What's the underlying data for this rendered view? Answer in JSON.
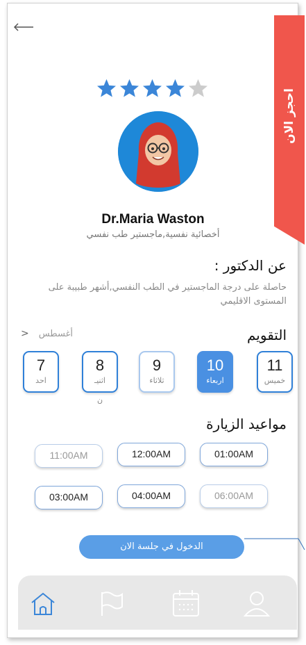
{
  "ribbon": {
    "label": "احجز الان"
  },
  "rating": {
    "value": 4,
    "max": 5,
    "filled_color": "#3b86d8",
    "empty_color": "#cccccc"
  },
  "doctor": {
    "name": "Dr.Maria Waston",
    "title": "أخصائية نفسية,ماجستير طب نفسي"
  },
  "about": {
    "heading": "عن الدكتور :",
    "text": "حاصلة على درجة الماجستير في الطب النفسي,أشهر طبيبة على المستوى الاقليمي"
  },
  "calendar": {
    "heading": "التقويم",
    "month": "أغسطس",
    "days": [
      {
        "num": "11",
        "label": "خميس",
        "active": false
      },
      {
        "num": "10",
        "label": "اربعاء",
        "active": true
      },
      {
        "num": "9",
        "label": "ثلاثاء",
        "active": false
      },
      {
        "num": "8",
        "label": "اثنيـ",
        "extra": "ن",
        "active": false
      },
      {
        "num": "7",
        "label": "احد",
        "active": false
      }
    ]
  },
  "visits": {
    "heading": "مواعيد الزيارة",
    "slots": [
      {
        "time": "11:00AM",
        "available": false
      },
      {
        "time": "12:00AM",
        "available": true
      },
      {
        "time": "01:00AM",
        "available": true
      },
      {
        "time": "03:00AM",
        "available": true
      },
      {
        "time": "04:00AM",
        "available": true
      },
      {
        "time": "06:00AM",
        "available": false
      }
    ]
  },
  "session_button": {
    "label": "الدخول في جلسة الان"
  },
  "colors": {
    "accent": "#4a90e2",
    "ribbon": "#f0564c",
    "nav_bg": "#e8e8e8"
  },
  "nav": {
    "items": [
      "home-icon",
      "flag-icon",
      "calendar-icon",
      "profile-icon"
    ]
  }
}
